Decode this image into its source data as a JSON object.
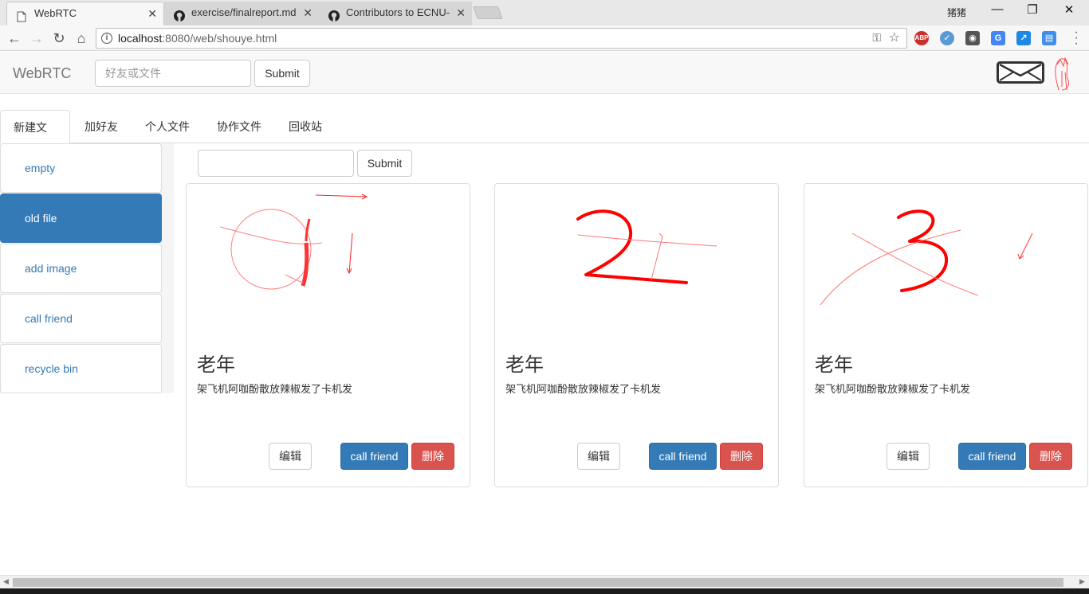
{
  "browser": {
    "tabs": [
      {
        "title": "WebRTC",
        "icon": "page-icon"
      },
      {
        "title": "exercise/finalreport.md",
        "icon": "github-icon"
      },
      {
        "title": "Contributors to ECNU-",
        "icon": "github-icon"
      }
    ],
    "profile_name": "猪猪",
    "url_host": "localhost",
    "url_rest": ":8080/web/shouye.html",
    "extensions": [
      "ABP",
      "check",
      "bulb",
      "translate",
      "arrow",
      "book"
    ]
  },
  "navbar": {
    "brand": "WebRTC",
    "search_placeholder": "好友或文件",
    "submit_label": "Submit"
  },
  "tabs": [
    "新建文件",
    "加好友",
    "个人文件",
    "协作文件",
    "回收站"
  ],
  "sidebar": {
    "items": [
      "empty",
      "old file",
      "add image",
      "call friend",
      "recycle bin"
    ],
    "active_index": 1
  },
  "content": {
    "search_value": "",
    "submit_label": "Submit"
  },
  "cards": [
    {
      "title": "老年",
      "desc": "架飞机阿咖酚散放辣椒发了卡机发",
      "edit_label": "编辑",
      "call_label": "call friend",
      "delete_label": "删除",
      "drawing": "number-one-sketch"
    },
    {
      "title": "老年",
      "desc": "架飞机阿咖酚散放辣椒发了卡机发",
      "edit_label": "编辑",
      "call_label": "call friend",
      "delete_label": "删除",
      "drawing": "number-two-sketch"
    },
    {
      "title": "老年",
      "desc": "架飞机阿咖酚散放辣椒发了卡机发",
      "edit_label": "编辑",
      "call_label": "call friend",
      "delete_label": "删除",
      "drawing": "number-three-sketch"
    }
  ],
  "colors": {
    "primary": "#337ab7",
    "danger": "#d9534f",
    "sketch": "#ff0000"
  }
}
